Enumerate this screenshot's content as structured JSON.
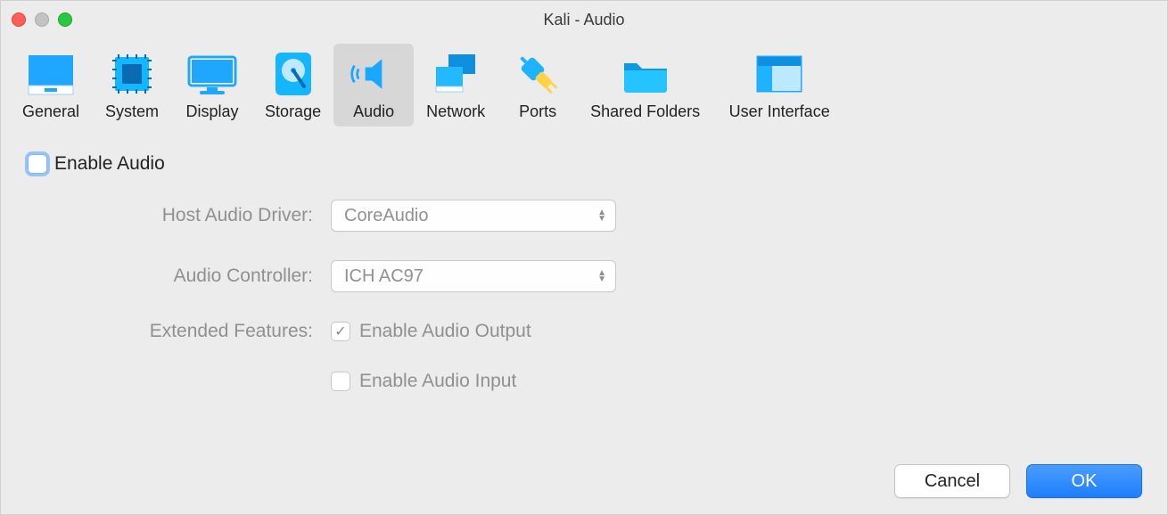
{
  "window": {
    "title": "Kali - Audio"
  },
  "tabs": [
    {
      "label": "General"
    },
    {
      "label": "System"
    },
    {
      "label": "Display"
    },
    {
      "label": "Storage"
    },
    {
      "label": "Audio"
    },
    {
      "label": "Network"
    },
    {
      "label": "Ports"
    },
    {
      "label": "Shared Folders"
    },
    {
      "label": "User Interface"
    }
  ],
  "content": {
    "enable_label": "Enable Audio",
    "host_driver_label": "Host Audio Driver:",
    "host_driver_value": "CoreAudio",
    "controller_label": "Audio Controller:",
    "controller_value": "ICH AC97",
    "extended_label": "Extended Features:",
    "output_label": "Enable Audio Output",
    "input_label": "Enable Audio Input"
  },
  "buttons": {
    "cancel": "Cancel",
    "ok": "OK"
  }
}
